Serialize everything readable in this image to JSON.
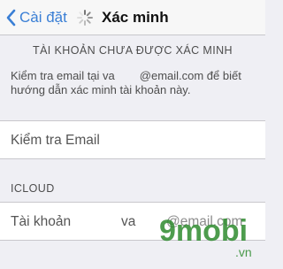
{
  "navbar": {
    "back_label": "Cài đặt",
    "title": "Xác minh",
    "icons": [
      "back-chevron-icon",
      "loading-spinner-icon"
    ],
    "accent_color": "#3a7fd5"
  },
  "verify_section": {
    "header": "TÀI KHOẢN CHƯA ĐƯỢC XÁC MINH",
    "line1_prefix": "Kiểm tra email tại va",
    "line1_suffix": "@email.com để biết",
    "line2": "hướng dẫn xác minh tài khoản này."
  },
  "email_cell": {
    "label": "Kiểm tra Email"
  },
  "icloud_section": {
    "header": "ICLOUD",
    "account_label": "Tài khoản",
    "account_user": "va",
    "account_domain": "@email.com"
  },
  "watermark": {
    "text_main": "9mobi",
    "text_sub": ".vn"
  }
}
